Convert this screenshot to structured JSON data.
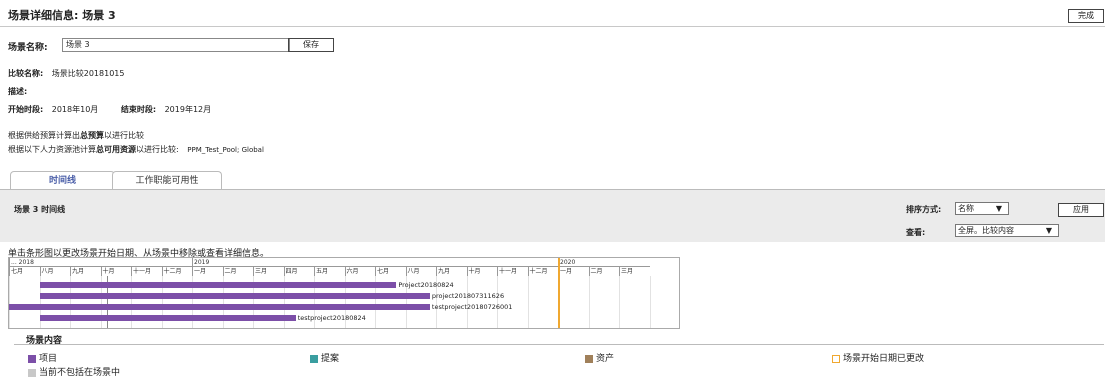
{
  "header": {
    "title": "场景详细信息: 场景 3",
    "done_label": "完成"
  },
  "scenario": {
    "name_label": "场景名称:",
    "name_value": "场景 3",
    "save_label": "保存",
    "compare_label": "比较名称:",
    "compare_value": "场景比较20181015",
    "desc_label": "描述:",
    "start_label": "开始时段:",
    "start_value": "2018年10月",
    "end_label": "结束时段:",
    "end_value": "2019年12月",
    "budget_pre": "根据供给预算计算出",
    "budget_bold": "总预算",
    "budget_post": "以进行比较",
    "pool_pre": "根据以下人力资源池计算",
    "pool_bold": "总可用资源",
    "pool_post": "以进行比较:",
    "pool_value": "PPM_Test_Pool; Global"
  },
  "tabs": [
    {
      "label": "时间线"
    },
    {
      "label": "工作职能可用性"
    }
  ],
  "panel": {
    "title": "场景 3 时间线",
    "sort_label": "排序方式:",
    "sort_value": "名称",
    "view_label": "查看:",
    "view_value": "全屏。比较内容",
    "apply_label": "应用"
  },
  "hint": "单击条形图以更改场景开始日期、从场景中移除或查看详细信息。",
  "timeline": {
    "years": [
      "... 2018",
      "2019",
      "2020"
    ],
    "months": [
      "七月",
      "八月",
      "九月",
      "十月",
      "十一月",
      "十二月",
      "一月",
      "二月",
      "三月",
      "四月",
      "五月",
      "六月",
      "七月",
      "八月",
      "九月",
      "十月",
      "十一月",
      "十二月",
      "一月",
      "二月",
      "三月"
    ],
    "projects": [
      {
        "name": "Project20180824"
      },
      {
        "name": "project201807311626"
      },
      {
        "name": "testproject20180726001"
      },
      {
        "name": "testproject20180824"
      }
    ]
  },
  "legend": {
    "title": "场景内容",
    "items": [
      {
        "label": "项目",
        "color": "#7c4fa8"
      },
      {
        "label": "提案",
        "color": "#3a9ea0"
      },
      {
        "label": "资产",
        "color": "#a0805a"
      },
      {
        "label": "场景开始日期已更改",
        "color": "#f0a830"
      }
    ],
    "excluded_label": "当前不包括在场景中",
    "excluded_color": "#c8c8c8"
  }
}
